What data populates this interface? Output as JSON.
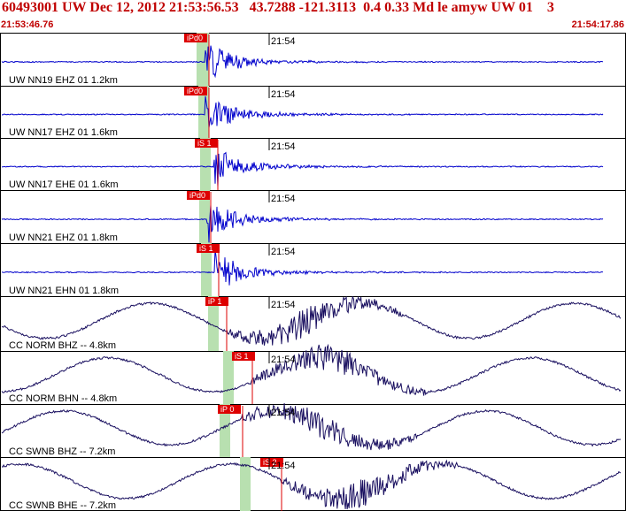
{
  "header": {
    "title": "60493001 UW Dec 12, 2012 21:53:56.53   43.7288 -121.3113  0.4 0.33 Md le amyw UW 01    3",
    "start_time": "21:53:46.76",
    "end_time": "21:54:17.86"
  },
  "colors": {
    "header_text": "#c00000",
    "trace_blue": "#0000cc",
    "trace_navy": "#1a1060",
    "pick_red": "#dd0000",
    "window_green": "#b8e0b0"
  },
  "panels": [
    {
      "label": "UW NN19 EHZ 01 1.2km",
      "time_tick": "21:54",
      "pick": "iPd0",
      "type": "local"
    },
    {
      "label": "UW NN17 EHZ 01 1.6km",
      "time_tick": "21:54",
      "pick": "iPd0",
      "type": "local"
    },
    {
      "label": "UW NN17 EHE 01 1.6km",
      "time_tick": "21:54",
      "pick": "iS 1",
      "type": "local"
    },
    {
      "label": "UW NN21 EHZ 01 1.8km",
      "time_tick": "21:54",
      "pick": "iPd0",
      "type": "local"
    },
    {
      "label": "UW NN21 EHN 01 1.8km",
      "time_tick": "21:54",
      "pick": "iS 1",
      "type": "local"
    },
    {
      "label": "CC NORM BHZ -- 4.8km",
      "time_tick": "21:54",
      "pick": "iP 1",
      "type": "broadband"
    },
    {
      "label": "CC NORM BHN -- 4.8km",
      "time_tick": "21:54",
      "pick": "iS 1",
      "type": "broadband"
    },
    {
      "label": "CC SWNB BHZ -- 7.2km",
      "time_tick": "21:54",
      "pick": "iP 0",
      "type": "broadband"
    },
    {
      "label": "CC SWNB BHE -- 7.2km",
      "time_tick": "21:54",
      "pick": "iS 2",
      "type": "broadband"
    }
  ]
}
